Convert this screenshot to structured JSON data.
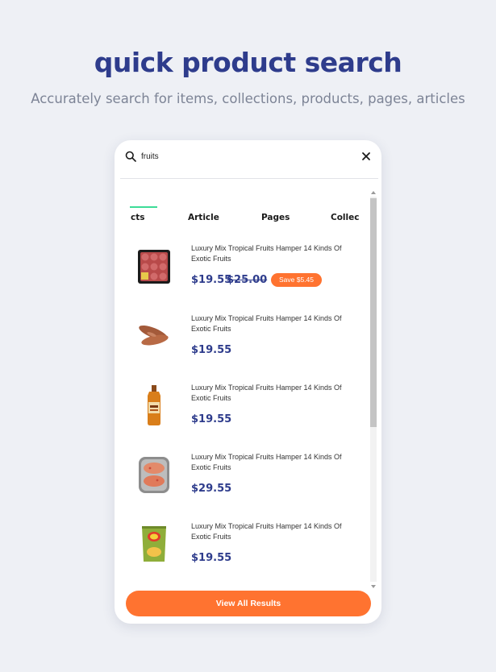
{
  "hero": {
    "title": "quick product search",
    "subtitle": "Accurately search for items, collections, products, pages, articles"
  },
  "search": {
    "value": "fruits",
    "search_icon": "search-icon",
    "close_icon": "close-icon"
  },
  "tabs": [
    {
      "label": "cts",
      "active": true
    },
    {
      "label": "Article",
      "active": false
    },
    {
      "label": "Pages",
      "active": false
    },
    {
      "label": "Collec",
      "active": false
    }
  ],
  "results": [
    {
      "title": "Luxury Mix Tropical Fruits Hamper 14 Kinds Of Exotic Fruits",
      "price": "$19.55",
      "old_price": "$25.00",
      "badge": "Save $5.45",
      "thumb": "ground-meat-tray"
    },
    {
      "title": "Luxury Mix Tropical Fruits Hamper 14 Kinds Of Exotic Fruits",
      "price": "$19.55",
      "thumb": "sweet-potatoes"
    },
    {
      "title": "Luxury Mix Tropical Fruits Hamper 14 Kinds Of Exotic Fruits",
      "price": "$19.55",
      "thumb": "whisky-bottle"
    },
    {
      "title": "Luxury Mix Tropical Fruits Hamper 14 Kinds Of Exotic Fruits",
      "price": "$29.55",
      "thumb": "fish-tray"
    },
    {
      "title": "Luxury Mix Tropical Fruits Hamper 14 Kinds Of Exotic Fruits",
      "price": "$19.55",
      "thumb": "chips-bag"
    }
  ],
  "footer": {
    "view_all_label": "View All Results"
  },
  "colors": {
    "brand_blue": "#2e3c8c",
    "accent_orange": "#ff7330",
    "tab_indicator_green": "#3ddc97",
    "background": "#eef0f5"
  }
}
